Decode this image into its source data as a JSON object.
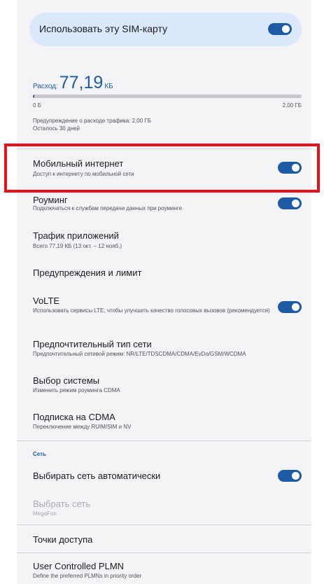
{
  "sim": {
    "label": "Использовать эту SIM-карту",
    "enabled": true
  },
  "usage": {
    "prefix": "Расход:",
    "value": "77,19",
    "unit": "КБ",
    "fraction_used": 4e-05,
    "min_label": "0 Б",
    "max_label": "2,00 ГБ",
    "warning": "Предупреждение о расходе трафика: 2,00 ГБ",
    "days_left": "Осталось 30 дней"
  },
  "settings": {
    "mobile_data": {
      "title": "Мобильный интернет",
      "subtitle": "Доступ к интернету по мобильной сети",
      "enabled": true
    },
    "roaming": {
      "title": "Роуминг",
      "subtitle": "Подключаться к службам передачи данных при роуминге",
      "enabled": true
    },
    "app_traffic": {
      "title": "Трафик приложений",
      "subtitle": "Всего 77,19 КБ (13 окт. – 12 нояб.)"
    },
    "warnings_limit": {
      "title": "Предупреждения и лимит"
    },
    "volte": {
      "title": "VoLTE",
      "subtitle": "Использовать сервисы LTE, чтобы улучшить качество голосовых вызовов (рекомендуется)",
      "enabled": true
    },
    "network_type": {
      "title": "Предпочтительный тип сети",
      "subtitle": "Предпочтительный сетевой режим: NR/LTE/TDSCDMA/CDMA/EvDo/GSM/WCDMA"
    },
    "system_select": {
      "title": "Выбор системы",
      "subtitle": "Изменить режим роуминга CDMA"
    },
    "cdma_subscription": {
      "title": "Подписка на CDMA",
      "subtitle": "Переключение между RUIM/SIM и NV"
    }
  },
  "network": {
    "section_label": "Сеть",
    "auto_select": {
      "title": "Выбирать сеть автоматически",
      "enabled": true
    },
    "choose_network": {
      "title": "Выбрать сеть",
      "subtitle": "MegaFon"
    },
    "access_points": {
      "title": "Точки доступа"
    },
    "plmn": {
      "title": "User Controlled PLMN",
      "subtitle": "Define the preferred PLMNs in priority order"
    }
  },
  "colors": {
    "accent": "#1e5aa6",
    "highlight": "#e8111a",
    "background": "#f4f4f7"
  }
}
